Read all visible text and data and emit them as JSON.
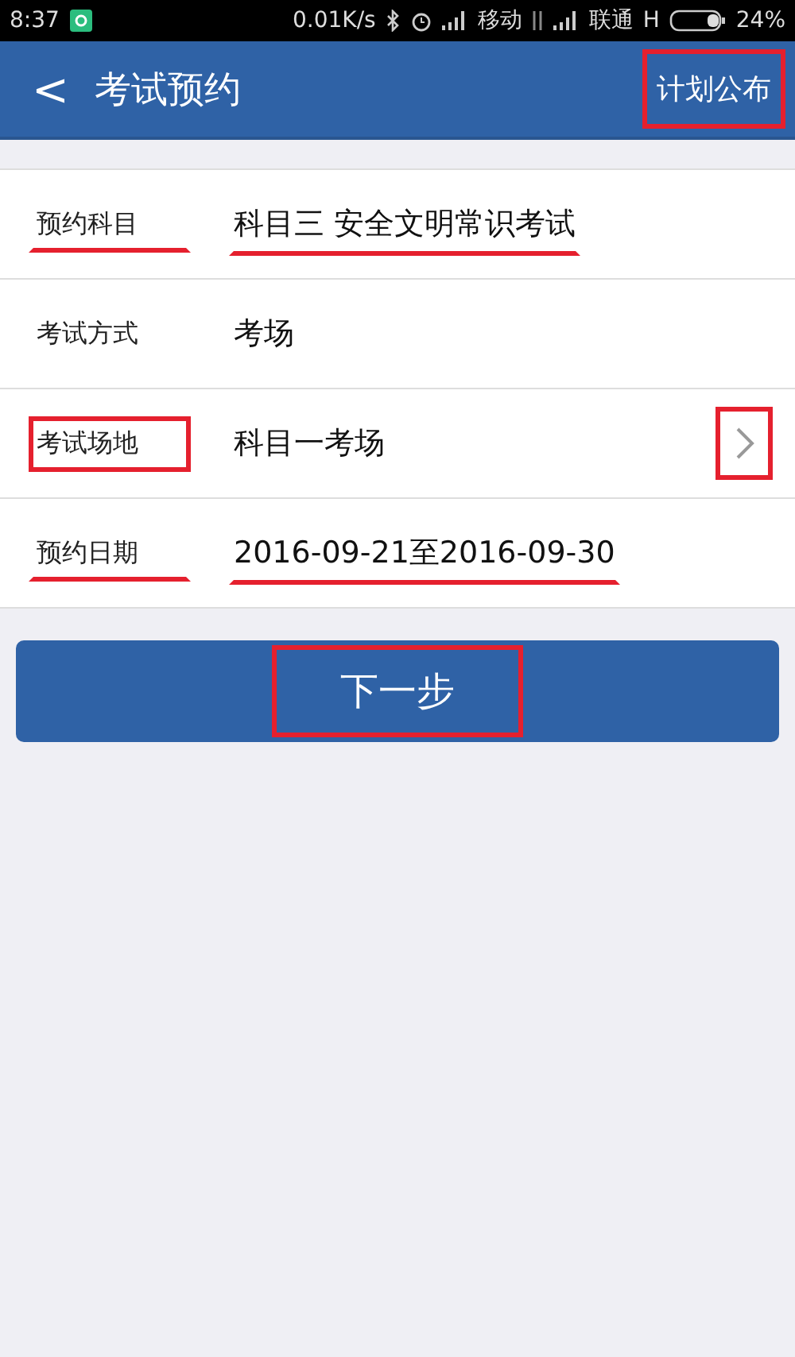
{
  "status_bar": {
    "time": "8:37",
    "speed": "0.01K/s",
    "carrier_1": "移动",
    "carrier_2": "联通",
    "network": "H",
    "battery": "24%"
  },
  "header": {
    "back": "<",
    "title": "考试预约",
    "action": {
      "label": "计划公布",
      "boxed": true
    }
  },
  "rows": [
    {
      "label": "预约科目",
      "label_boxed": false,
      "label_underlined": true,
      "value": "科目三 安全文明常识考试",
      "value_underlined": true,
      "has_arrow": false
    },
    {
      "label": "考试方式",
      "label_boxed": false,
      "label_underlined": false,
      "value": "考场",
      "value_underlined": false,
      "has_arrow": false
    },
    {
      "label": "考试场地",
      "label_boxed": true,
      "label_underlined": false,
      "value": "科目一考场",
      "value_underlined": false,
      "has_arrow": true,
      "arrow_boxed": true
    },
    {
      "label": "预约日期",
      "label_boxed": false,
      "label_underlined": true,
      "value": "2016-09-21至2016-09-30",
      "value_underlined": true,
      "has_arrow": false
    }
  ],
  "next_button": {
    "label": "下一步",
    "boxed": true
  }
}
